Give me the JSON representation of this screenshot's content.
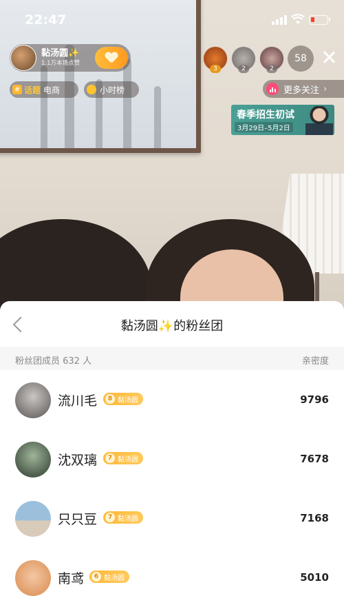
{
  "status_bar": {
    "time": "22:47"
  },
  "host": {
    "name": "黏汤圆✨",
    "likes": "1.1万本场点赞",
    "follow_level": "7"
  },
  "tags": {
    "topic_badge": "#",
    "topic_word": "话题",
    "topic_value": "电商",
    "rank_label": "小时榜"
  },
  "viewers": [
    {
      "badge": "3"
    },
    {
      "badge": "2"
    },
    {
      "badge": "2"
    }
  ],
  "viewer_count": "58",
  "more_follow": {
    "label": "更多关注",
    "arrow": "›"
  },
  "promo": {
    "title": "春季招生初试",
    "date": "3月29日–5月2日"
  },
  "fan_club": {
    "title_prefix": "黏汤圆",
    "title_sparkle": "✨",
    "title_suffix": "的粉丝团",
    "member_count": "粉丝团成员 632 人",
    "intimacy_label": "亲密度",
    "members": [
      {
        "name": "流川毛",
        "level": "8",
        "badge": "黏汤圆",
        "score": "9796"
      },
      {
        "name": "沈双璃",
        "level": "7",
        "badge": "黏汤圆",
        "score": "7678"
      },
      {
        "name": "只只豆",
        "level": "7",
        "badge": "黏汤圆",
        "score": "7168"
      },
      {
        "name": "南鸢",
        "level": "6",
        "badge": "黏汤圆",
        "score": "5010"
      }
    ]
  },
  "colors": {
    "accent": "#ffb93a",
    "promo": "#4a9f95",
    "badge_text": "#ffffff"
  }
}
